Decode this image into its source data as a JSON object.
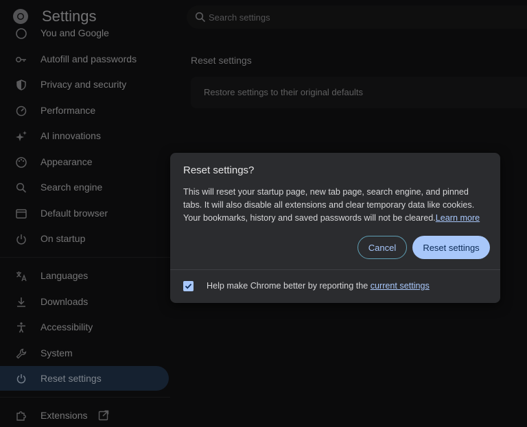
{
  "header": {
    "title": "Settings",
    "search_placeholder": "Search settings"
  },
  "sidebar": {
    "items": [
      {
        "label": "You and Google",
        "icon": "google-person-icon"
      },
      {
        "label": "Autofill and passwords",
        "icon": "key-icon"
      },
      {
        "label": "Privacy and security",
        "icon": "shield-icon"
      },
      {
        "label": "Performance",
        "icon": "gauge-icon"
      },
      {
        "label": "AI innovations",
        "icon": "sparkle-icon"
      },
      {
        "label": "Appearance",
        "icon": "palette-icon"
      },
      {
        "label": "Search engine",
        "icon": "search-icon"
      },
      {
        "label": "Default browser",
        "icon": "browser-window-icon"
      },
      {
        "label": "On startup",
        "icon": "power-icon"
      },
      {
        "label": "Languages",
        "icon": "translate-icon"
      },
      {
        "label": "Downloads",
        "icon": "download-icon"
      },
      {
        "label": "Accessibility",
        "icon": "accessibility-icon"
      },
      {
        "label": "System",
        "icon": "wrench-icon"
      },
      {
        "label": "Reset settings",
        "icon": "reset-icon",
        "active": true
      },
      {
        "label": "Extensions",
        "icon": "puzzle-icon"
      }
    ]
  },
  "main": {
    "section_title": "Reset settings",
    "card_row": "Restore settings to their original defaults"
  },
  "dialog": {
    "title": "Reset settings?",
    "body": "This will reset your startup page, new tab page, search engine, and pinned tabs. It will also disable all extensions and clear temporary data like cookies. Your bookmarks, history and saved passwords will not be cleared.",
    "learn_more": "Learn more",
    "cancel": "Cancel",
    "reset": "Reset settings",
    "checkbox_text": "Help make Chrome better by reporting the ",
    "checkbox_link": "current settings",
    "checkbox_checked": true
  },
  "colors": {
    "accent": "#a8c7fa",
    "active_nav": "#1d2c40",
    "dialog_bg": "#2b2c2f"
  }
}
